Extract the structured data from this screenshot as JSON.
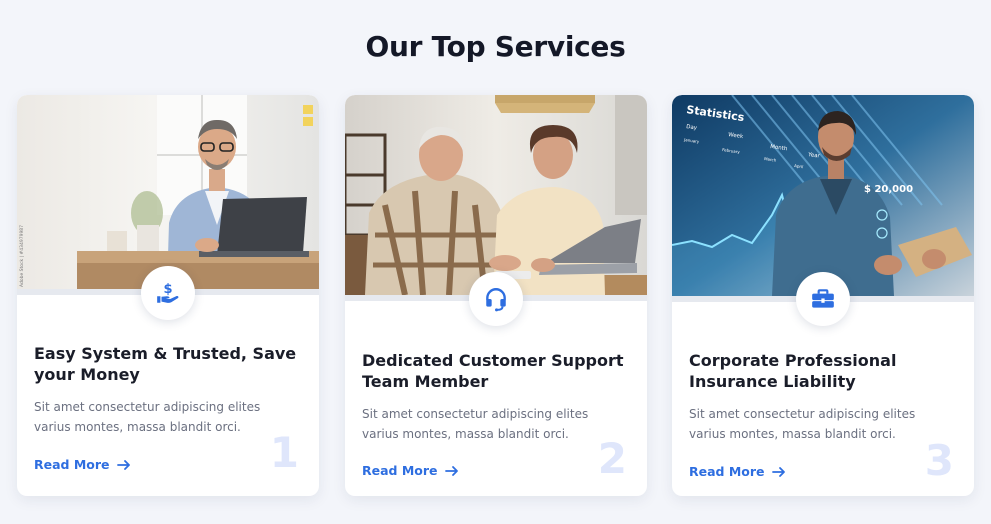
{
  "section": {
    "title": "Our Top Services"
  },
  "colors": {
    "accent": "#2e6ee0",
    "number": "#dfe6fb",
    "background": "#f3f5fa"
  },
  "cards": [
    {
      "title": "Easy System & Trusted, Save your Money",
      "text": "Sit amet consectetur adipiscing elites varius montes, massa blandit orci.",
      "link": "Read More",
      "number": "1",
      "icon": "hand-dollar-icon",
      "photo_watermark": "Adobe Stock | #434979987"
    },
    {
      "title": "Dedicated Customer Support Team Member",
      "text": "Sit amet consectetur adipiscing elites varius montes, massa blandit orci.",
      "link": "Read More",
      "number": "2",
      "icon": "headset-icon"
    },
    {
      "title": "Corporate Professional Insurance Liability",
      "text": "Sit amet consectetur adipiscing elites varius montes, massa blandit orci.",
      "link": "Read More",
      "number": "3",
      "icon": "briefcase-icon",
      "photo_overlay": {
        "title": "Statistics",
        "tabs": [
          "Day",
          "Week",
          "Month",
          "Year"
        ],
        "labels": [
          "January",
          "February",
          "March",
          "April"
        ],
        "value": "$ 20,000"
      }
    }
  ]
}
